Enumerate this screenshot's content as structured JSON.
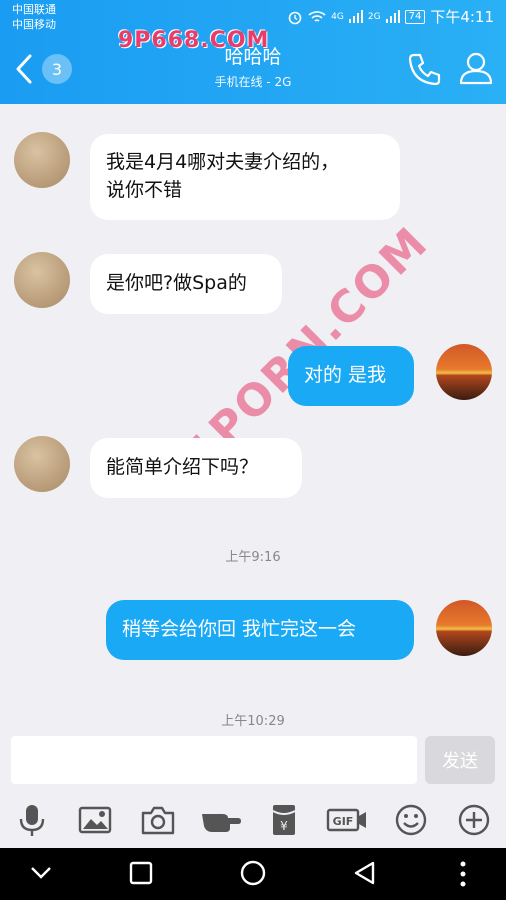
{
  "status_bar": {
    "carrier_1": "中国联通",
    "carrier_2": "中国移动",
    "net_1": "4G",
    "net_2": "2G",
    "battery": "74",
    "time": "下午4:11"
  },
  "header": {
    "back_badge": "3",
    "title": "哈哈哈",
    "subtitle": "手机在线 - 2G",
    "watermark": "9P668.COM"
  },
  "watermark_diagonal": "91PORN.COM",
  "messages": [
    {
      "side": "in",
      "text_line1": "我是4月4哪对夫妻介绍的，",
      "text_line2": "说你不错"
    },
    {
      "side": "in",
      "text": "是你吧?做Spa的"
    },
    {
      "side": "out",
      "text": "对的 是我"
    },
    {
      "side": "in",
      "text": "能简单介绍下吗？"
    },
    {
      "side": "time",
      "text": "上午9:16"
    },
    {
      "side": "out",
      "text": "稍等会给你回 我忙完这一会"
    },
    {
      "side": "time",
      "text": "上午10:29"
    }
  ],
  "input": {
    "placeholder": "",
    "send_label": "发送"
  },
  "toolbar_icons": [
    "mic-icon",
    "image-icon",
    "camera-icon",
    "hand-icon",
    "red-packet-icon",
    "gif-icon",
    "emoji-icon",
    "plus-icon"
  ],
  "nav_icons": [
    "chevron-down-icon",
    "square-icon",
    "circle-icon",
    "triangle-back-icon",
    "more-dots-icon"
  ]
}
